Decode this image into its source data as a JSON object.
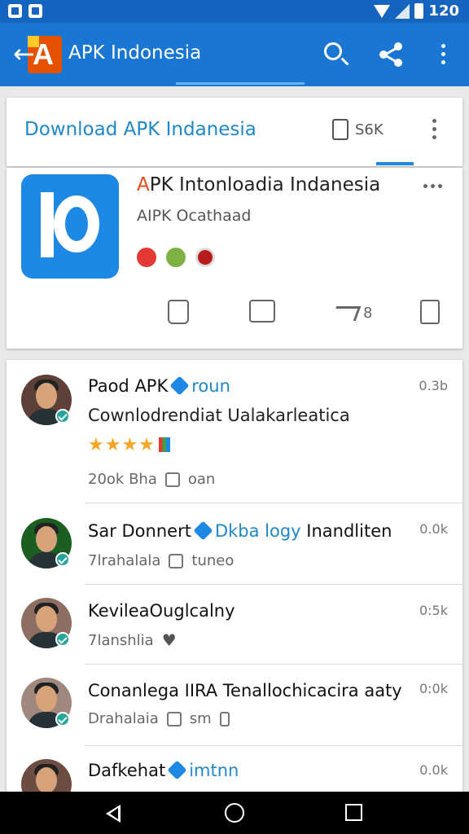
{
  "status_bar": {
    "time": "120"
  },
  "app_bar": {
    "title": "APK Indonesia",
    "icons": [
      "back-arrow-icon",
      "app-logo",
      "search-icon",
      "share-icon",
      "more-vert-icon"
    ]
  },
  "header": {
    "title": "Download APK Indanesia",
    "count": "S6K"
  },
  "app_card": {
    "name_first": "A",
    "name_rest": "PK Intonloadia Indanesia",
    "subtitle": "AIPK Ocathaad",
    "share_count": "8"
  },
  "comments": [
    {
      "name": "Paod APK",
      "tag": "roun",
      "time": "0.3b",
      "text": "Cownlodrendiat Ualakarleatica",
      "meta": "20ok Bha",
      "meta2": "oan",
      "rating": "★★★★"
    },
    {
      "name": "Sar Donnert",
      "tag": "Dkba logy",
      "name_suffix": "Inandliten",
      "time": "0.0k",
      "meta": "7lrahalala",
      "meta2": "tuneo"
    },
    {
      "name": "KevileaOuglcalny",
      "time": "0:5k",
      "meta": "7lanshlia"
    },
    {
      "name": "Conanlega IIRA Tenallochicacira aaty",
      "time": "0:0k",
      "meta": "Drahalaia",
      "meta2": "sm"
    },
    {
      "name": "Dafkehat",
      "tag": "imtnn",
      "time": "0.0k"
    }
  ],
  "colors": {
    "app_bar": "#1976d2",
    "status_bar": "#1565c0",
    "accent": "#1e88e5",
    "star": "#f5a623"
  }
}
